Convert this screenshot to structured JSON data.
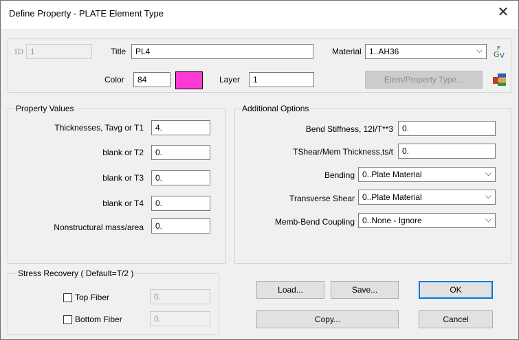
{
  "window": {
    "title": "Define Property - PLATE Element Type",
    "close_glyph": "✕"
  },
  "header": {
    "id_label": "ID",
    "id_value": "1",
    "title_label": "Title",
    "title_value": "PL4",
    "material_label": "Material",
    "material_value": "1..AH36",
    "color_label": "Color",
    "color_value": "84",
    "color_swatch": "#fe3ad6",
    "layer_label": "Layer",
    "layer_value": "1",
    "elem_property_type_label": "Elem/Property Type..."
  },
  "property_values": {
    "group_label": "Property Values",
    "rows": [
      {
        "label": "Thicknesses, Tavg or T1",
        "value": "4."
      },
      {
        "label": "blank or T2",
        "value": "0."
      },
      {
        "label": "blank or T3",
        "value": "0."
      },
      {
        "label": "blank or T4",
        "value": "0."
      },
      {
        "label": "Nonstructural mass/area",
        "value": "0."
      }
    ]
  },
  "additional_options": {
    "group_label": "Additional Options",
    "bend_stiffness_label": "Bend Stiffness,  12I/T**3",
    "bend_stiffness_value": "0.",
    "tshear_label": "TShear/Mem Thickness,ts/t",
    "tshear_value": "0.",
    "bending_label": "Bending",
    "bending_value": "0..Plate Material",
    "transverse_shear_label": "Transverse Shear",
    "transverse_shear_value": "0..Plate Material",
    "memb_bend_label": "Memb-Bend Coupling",
    "memb_bend_value": "0..None - Ignore"
  },
  "stress_recovery": {
    "group_label": "Stress Recovery ( Default=T/2 )",
    "top_fiber_label": "Top Fiber",
    "top_fiber_value": "0.",
    "bottom_fiber_label": "Bottom Fiber",
    "bottom_fiber_value": "0."
  },
  "buttons": {
    "load": "Load...",
    "save": "Save...",
    "ok": "OK",
    "copy": "Copy...",
    "cancel": "Cancel"
  },
  "icons": {
    "chevron": "chevron-down-icon",
    "material_icon": "material-library-icon",
    "elem_type_icon": "element-type-icon"
  }
}
